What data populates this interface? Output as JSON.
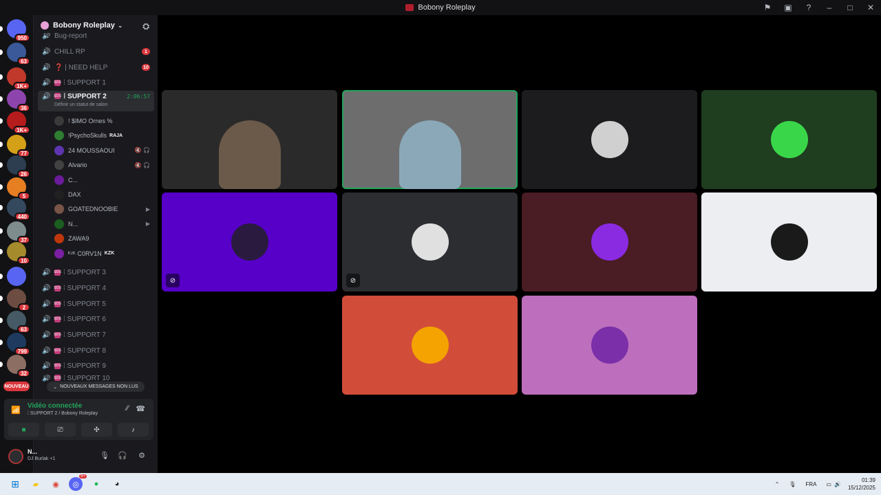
{
  "window": {
    "title": "Bobony Roleplay"
  },
  "titlebar_icons": [
    "inbox-icon",
    "window-icon",
    "help-icon",
    "minimize-icon",
    "maximize-icon",
    "close-icon"
  ],
  "rail": {
    "servers": [
      {
        "badge": "950",
        "color": "#5865f2"
      },
      {
        "badge": "63",
        "color": "#3b5998"
      },
      {
        "badge": "1K+",
        "color": "#c0392b"
      },
      {
        "badge": "36",
        "color": "#8e44ad"
      },
      {
        "badge": "1K+",
        "color": "#b71c1c"
      },
      {
        "badge": "77",
        "color": "#d4a017"
      },
      {
        "badge": "26",
        "color": "#2c3e50"
      },
      {
        "badge": "5",
        "color": "#e67e22"
      },
      {
        "badge": "440",
        "color": "#34495e"
      },
      {
        "badge": "37",
        "color": "#7f8c8d"
      },
      {
        "badge": "10",
        "color": "#a68b2c"
      },
      {
        "badge": "",
        "color": "#5865f2"
      },
      {
        "badge": "2",
        "color": "#6d4c41"
      },
      {
        "badge": "63",
        "color": "#455a64"
      },
      {
        "badge": "799",
        "color": "#1e3a5f"
      },
      {
        "badge": "32",
        "color": "#8d6e63"
      }
    ],
    "new_label": "NOUVEAU"
  },
  "guild": {
    "name": "Bobony Roleplay"
  },
  "channels": {
    "top_partial": "Bug-report",
    "list": [
      {
        "name": "CHILL RP",
        "badge": "1"
      },
      {
        "name": "❓ | NEED HELP",
        "badge": "10"
      },
      {
        "name": "⁞ SUPPORT 1",
        "badge": ""
      }
    ],
    "active": {
      "name": "⁞ SUPPORT 2",
      "timer": "2:06:57",
      "status": "Définir un statut de salon"
    },
    "members": [
      {
        "name": "! $IMO Ornes %",
        "right": "",
        "tag": "",
        "color": "#3a3a3a"
      },
      {
        "name": "!PsychoSkulls",
        "right": "",
        "tag": "RAJA",
        "color": "#2e7d32"
      },
      {
        "name": "24 MOUSSAOUI",
        "right": "🔇 🎧",
        "tag": "",
        "color": "#5e35b1"
      },
      {
        "name": "Alvario",
        "right": "🔇 🎧",
        "tag": "",
        "color": "#424242"
      },
      {
        "name": "C...",
        "right": "",
        "tag": "",
        "color": "#6a1b9a"
      },
      {
        "name": "DAX",
        "right": "",
        "tag": "",
        "color": "#212121"
      },
      {
        "name": "GOATEDNOOBIE",
        "right": "▶",
        "tag": "",
        "color": "#795548"
      },
      {
        "name": "N...",
        "right": "▶",
        "tag": "",
        "color": "#1b5e20"
      },
      {
        "name": "ZAWA9",
        "right": "",
        "tag": "",
        "color": "#bf360c"
      },
      {
        "name": "ᴷᶻᴷ C0RV1N",
        "right": "",
        "tag": "KZK",
        "color": "#7b1fa2"
      }
    ],
    "after": [
      {
        "name": "⁞ SUPPORT 3"
      },
      {
        "name": "⁞ SUPPORT 4"
      },
      {
        "name": "⁞ SUPPORT 5"
      },
      {
        "name": "⁞ SUPPORT 6"
      },
      {
        "name": "⁞ SUPPORT 7"
      },
      {
        "name": "⁞ SUPPORT 8"
      },
      {
        "name": "⁞ SUPPORT 9"
      },
      {
        "name": "⁞ SUPPORT 10"
      }
    ],
    "unread_pill": "NOUVEAUX MESSAGES NON LUS"
  },
  "voice": {
    "title": "Vidéo connectée",
    "subtitle": "⁞ SUPPORT 2 / Bobony Roleplay"
  },
  "user": {
    "name": "N...",
    "status": "DJ Burlak +1"
  },
  "tiles": [
    {
      "kind": "video",
      "bg": "#2a2a2a",
      "muted": false
    },
    {
      "kind": "video",
      "bg": "#6d6d6d",
      "muted": false,
      "speaking": true
    },
    {
      "kind": "avatar",
      "bg": "#1c1c1e",
      "av": "#d0d0d0",
      "muted": false
    },
    {
      "kind": "avatar",
      "bg": "#1f3d1f",
      "av": "#3ad64a",
      "muted": false
    },
    {
      "kind": "avatar",
      "bg": "#5600c8",
      "av": "#2a1a40",
      "muted": true
    },
    {
      "kind": "avatar",
      "bg": "#2b2d31",
      "av": "#e0e0e0",
      "muted": true
    },
    {
      "kind": "avatar",
      "bg": "#4a1c24",
      "av": "#8a2be2",
      "muted": false
    },
    {
      "kind": "avatar",
      "bg": "#eceef2",
      "av": "#1a1a1a",
      "muted": false
    },
    {
      "kind": "avatar",
      "bg": "#d24d39",
      "av": "#f4a300",
      "muted": false
    },
    {
      "kind": "avatar",
      "bg": "#bd6fbd",
      "av": "#7b2fa8",
      "muted": false
    }
  ],
  "taskbar": {
    "lang": "FRA",
    "time": "01:39",
    "date": "15/12/2025",
    "discord_badge": "9+"
  }
}
